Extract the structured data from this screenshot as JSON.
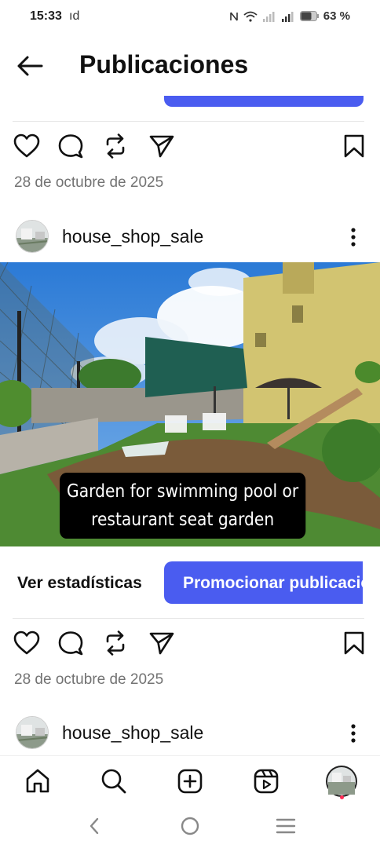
{
  "status_bar": {
    "time": "15:33",
    "carrier_id": "ıd",
    "battery": "63 %"
  },
  "header": {
    "title": "Publicaciones"
  },
  "posts": [
    {
      "date": "28 de octubre de 2025"
    },
    {
      "username": "house_shop_sale",
      "caption": "Garden for swimming pool or restaurant seat garden",
      "insights_label": "Ver estadísticas",
      "promote_label": "Promocionar publicación",
      "date": "28 de octubre de 2025"
    },
    {
      "username": "house_shop_sale"
    }
  ],
  "icons": {
    "back": "arrow-left-icon",
    "like": "heart-icon",
    "comment": "comment-icon",
    "repost": "repost-icon",
    "share": "send-icon",
    "save": "bookmark-icon",
    "more": "more-vertical-icon",
    "home": "home-icon",
    "search": "search-icon",
    "create": "plus-square-icon",
    "reels": "reels-icon"
  },
  "colors": {
    "accent": "#4a5cf0",
    "text": "#111111",
    "muted": "#737373",
    "notification_dot": "#ff2d55"
  }
}
